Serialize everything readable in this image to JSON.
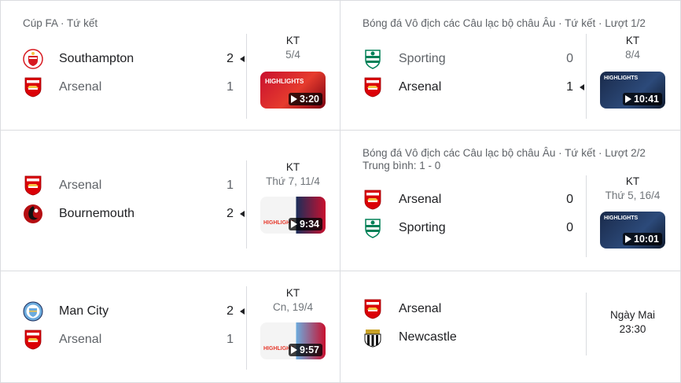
{
  "colors": {
    "border": "#dadce0",
    "muted": "#5f6368",
    "arsenal": "#db0007",
    "southampton": "#d71920",
    "bournemouth": "#b50e12",
    "mancity": "#6cabdd",
    "sporting": "#008057"
  },
  "matches": [
    {
      "competition": "Cúp FA · Tứ kết",
      "home": {
        "name": "Southampton",
        "score": "2",
        "crest": "southampton-crest-icon"
      },
      "away": {
        "name": "Arsenal",
        "score": "1",
        "crest": "arsenal-crest-icon"
      },
      "status": "KT",
      "date": "5/4",
      "duration": "3:20",
      "thumb_text": "HIGHLIGHTS"
    },
    {
      "competition": "Bóng đá Vô địch các Câu lạc bộ châu Âu · Tứ kết · Lượt 1/2",
      "home": {
        "name": "Sporting",
        "score": "0",
        "crest": "sporting-crest-icon"
      },
      "away": {
        "name": "Arsenal",
        "score": "1",
        "crest": "arsenal-crest-icon"
      },
      "status": "KT",
      "date": "8/4",
      "duration": "10:41",
      "thumb_text": "HIGHLIGHTS"
    },
    {
      "competition": "",
      "home": {
        "name": "Arsenal",
        "score": "1",
        "crest": "arsenal-crest-icon"
      },
      "away": {
        "name": "Bournemouth",
        "score": "2",
        "crest": "bournemouth-crest-icon"
      },
      "status": "KT",
      "date": "Thứ 7, 11/4",
      "duration": "9:34",
      "thumb_text": "HIGHLIGHT"
    },
    {
      "competition": "Bóng đá Vô địch các Câu lạc bộ châu Âu · Tứ kết · Lượt 2/2",
      "aggregate": "Trung bình: 1 - 0",
      "home": {
        "name": "Arsenal",
        "score": "0",
        "crest": "arsenal-crest-icon"
      },
      "away": {
        "name": "Sporting",
        "score": "0",
        "crest": "sporting-crest-icon"
      },
      "status": "KT",
      "date": "Thứ 5, 16/4",
      "duration": "10:01",
      "thumb_text": "HIGHLIGHTS"
    },
    {
      "competition": "",
      "home": {
        "name": "Man City",
        "score": "2",
        "crest": "mancity-crest-icon"
      },
      "away": {
        "name": "Arsenal",
        "score": "1",
        "crest": "arsenal-crest-icon"
      },
      "status": "KT",
      "date": "Cn, 19/4",
      "duration": "9:57",
      "thumb_text": "HIGHLIGHT"
    },
    {
      "competition": "",
      "home": {
        "name": "Arsenal",
        "crest": "arsenal-crest-icon"
      },
      "away": {
        "name": "Newcastle",
        "crest": "newcastle-crest-icon"
      },
      "day": "Ngày Mai",
      "time": "23:30"
    }
  ]
}
